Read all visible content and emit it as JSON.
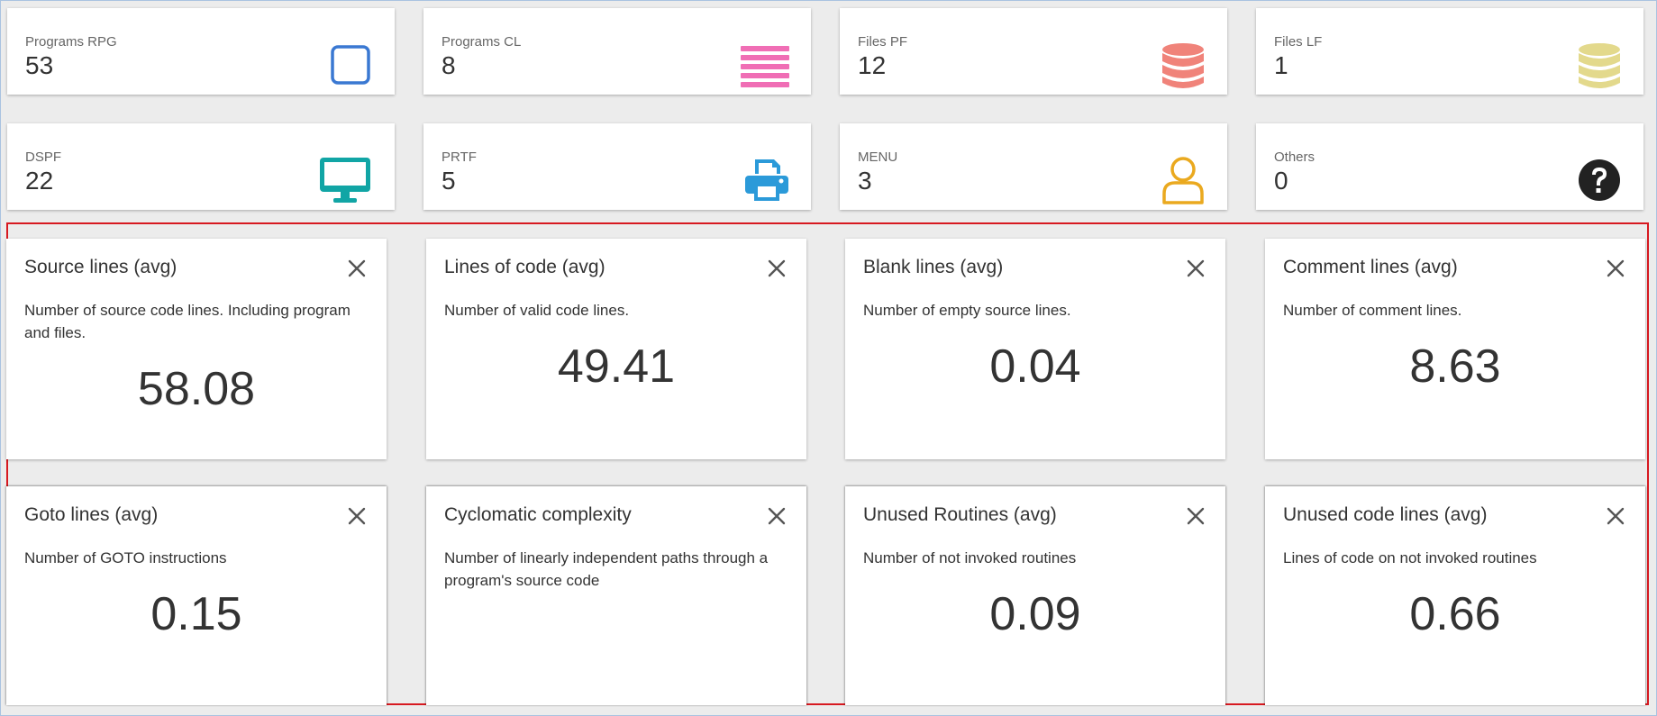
{
  "stats": [
    {
      "label": "Programs RPG",
      "value": "53",
      "icon": "square-outline-icon",
      "color": "#3a78d2"
    },
    {
      "label": "Programs CL",
      "value": "8",
      "icon": "bars-icon",
      "color": "#f06eb5"
    },
    {
      "label": "Files PF",
      "value": "12",
      "icon": "database-icon",
      "color": "#f0837a"
    },
    {
      "label": "Files LF",
      "value": "1",
      "icon": "database-icon",
      "color": "#e3d98c"
    },
    {
      "label": "DSPF",
      "value": "22",
      "icon": "desktop-icon",
      "color": "#11a5a5"
    },
    {
      "label": "PRTF",
      "value": "5",
      "icon": "printer-icon",
      "color": "#2b9ad9"
    },
    {
      "label": "MENU",
      "value": "3",
      "icon": "user-icon",
      "color": "#eaa91f"
    },
    {
      "label": "Others",
      "value": "0",
      "icon": "question-circle-icon",
      "color": "#222222"
    }
  ],
  "metrics": [
    {
      "title": "Source lines (avg)",
      "description": "Number of source code lines. Including program and files.",
      "value": "58.08"
    },
    {
      "title": "Lines of code (avg)",
      "description": "Number of valid code lines.",
      "value": "49.41"
    },
    {
      "title": "Blank lines (avg)",
      "description": "Number of empty source lines.",
      "value": "0.04"
    },
    {
      "title": "Comment lines (avg)",
      "description": "Number of comment lines.",
      "value": "8.63"
    },
    {
      "title": "Goto lines (avg)",
      "description": "Number of GOTO instructions",
      "value": "0.15"
    },
    {
      "title": "Cyclomatic complexity",
      "description": "Number of linearly independent paths through a program's source code",
      "value": ""
    },
    {
      "title": "Unused Routines (avg)",
      "description": "Number of not invoked routines",
      "value": "0.09"
    },
    {
      "title": "Unused code lines (avg)",
      "description": "Lines of code on not invoked routines",
      "value": "0.66"
    }
  ],
  "colors": {
    "highlight_border": "#d71920",
    "background": "#ececec",
    "close_icon": "#555555"
  }
}
